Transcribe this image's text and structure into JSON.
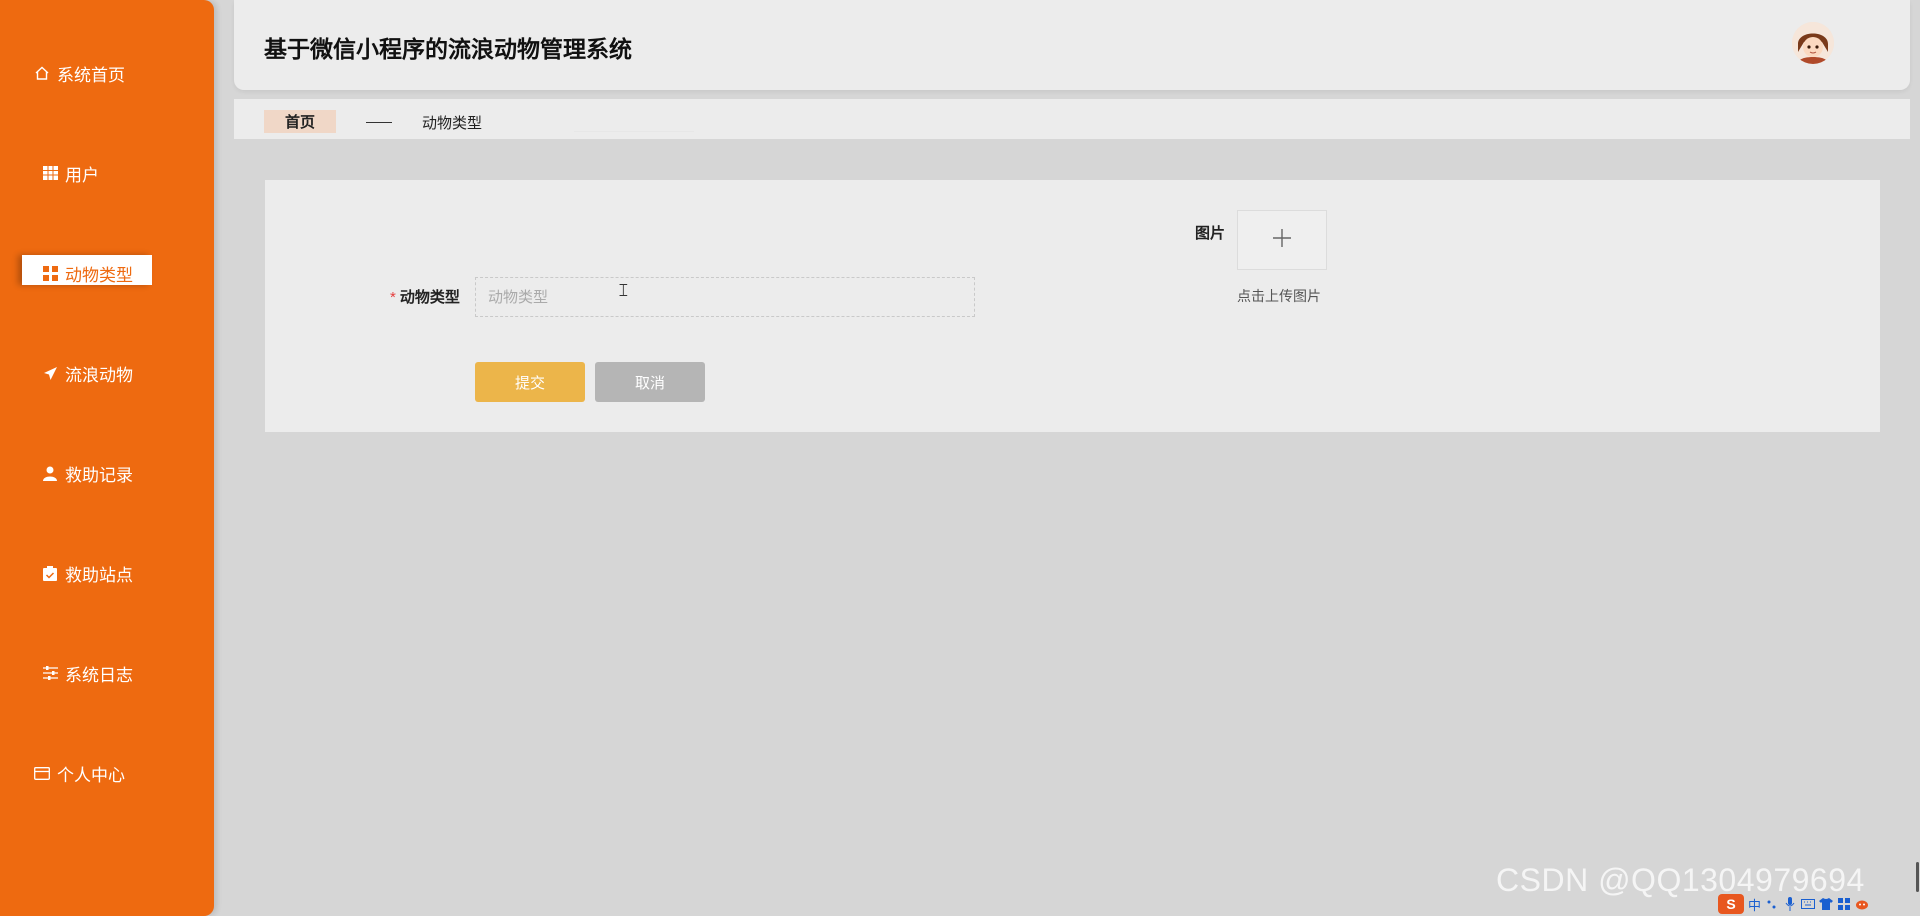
{
  "app": {
    "title": "基于微信小程序的流浪动物管理系统"
  },
  "sidebar": {
    "items": [
      {
        "label": "系统首页",
        "icon": "home-icon"
      },
      {
        "label": "用户",
        "icon": "table-icon"
      },
      {
        "label": "动物类型",
        "icon": "grid-icon",
        "active": true
      },
      {
        "label": "流浪动物",
        "icon": "send-icon"
      },
      {
        "label": "救助记录",
        "icon": "user-icon"
      },
      {
        "label": "救助站点",
        "icon": "clipboard-icon"
      },
      {
        "label": "系统日志",
        "icon": "sliders-icon"
      },
      {
        "label": "个人中心",
        "icon": "card-icon"
      }
    ]
  },
  "breadcrumb": {
    "home": "首页",
    "current": "动物类型"
  },
  "form": {
    "type_label": "动物类型",
    "required_mark": "*",
    "type_placeholder": "动物类型",
    "type_value": "",
    "image_label": "图片",
    "upload_hint": "点击上传图片",
    "submit_label": "提交",
    "cancel_label": "取消"
  },
  "watermark": "CSDN @QQ1304979694",
  "taskbar": {
    "ime_logo": "S",
    "ime_mode": "中"
  },
  "colors": {
    "sidebar": "#ee6a10",
    "submit": "#ecb54a",
    "cancel": "#b5b5b5",
    "crumb_home_bg": "#f0d7c7"
  }
}
